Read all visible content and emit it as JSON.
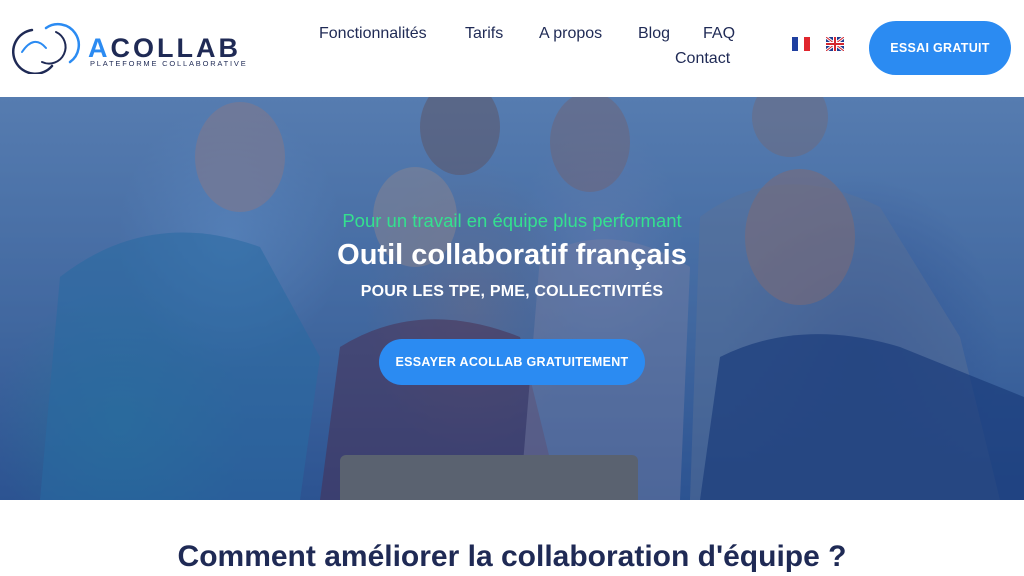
{
  "header": {
    "logo": {
      "wordmark_a": "A",
      "wordmark_rest": "COLLAB",
      "tagline": "PLATEFORME COLLABORATIVE"
    },
    "nav": [
      {
        "label": "Fonctionnalités"
      },
      {
        "label": "Tarifs"
      },
      {
        "label": "A propos"
      },
      {
        "label": "Blog"
      },
      {
        "label": "FAQ"
      },
      {
        "label": "Contact"
      }
    ],
    "flags": {
      "fr": "flag-fr-icon",
      "uk": "flag-uk-icon"
    },
    "cta_label": "ESSAI GRATUIT"
  },
  "hero": {
    "subtitle": "Pour un travail en équipe plus performant",
    "title": "Outil collaboratif français",
    "tagline": "POUR LES TPE, PME, COLLECTIVITÉS",
    "cta_label": "ESSAYER ACOLLAB GRATUITEMENT"
  },
  "section": {
    "title": "Comment améliorer la collaboration d'équipe ?"
  },
  "colors": {
    "brand_blue": "#2b8bf2",
    "navy": "#1f2a55",
    "accent_green": "#34e08f",
    "white": "#ffffff"
  }
}
